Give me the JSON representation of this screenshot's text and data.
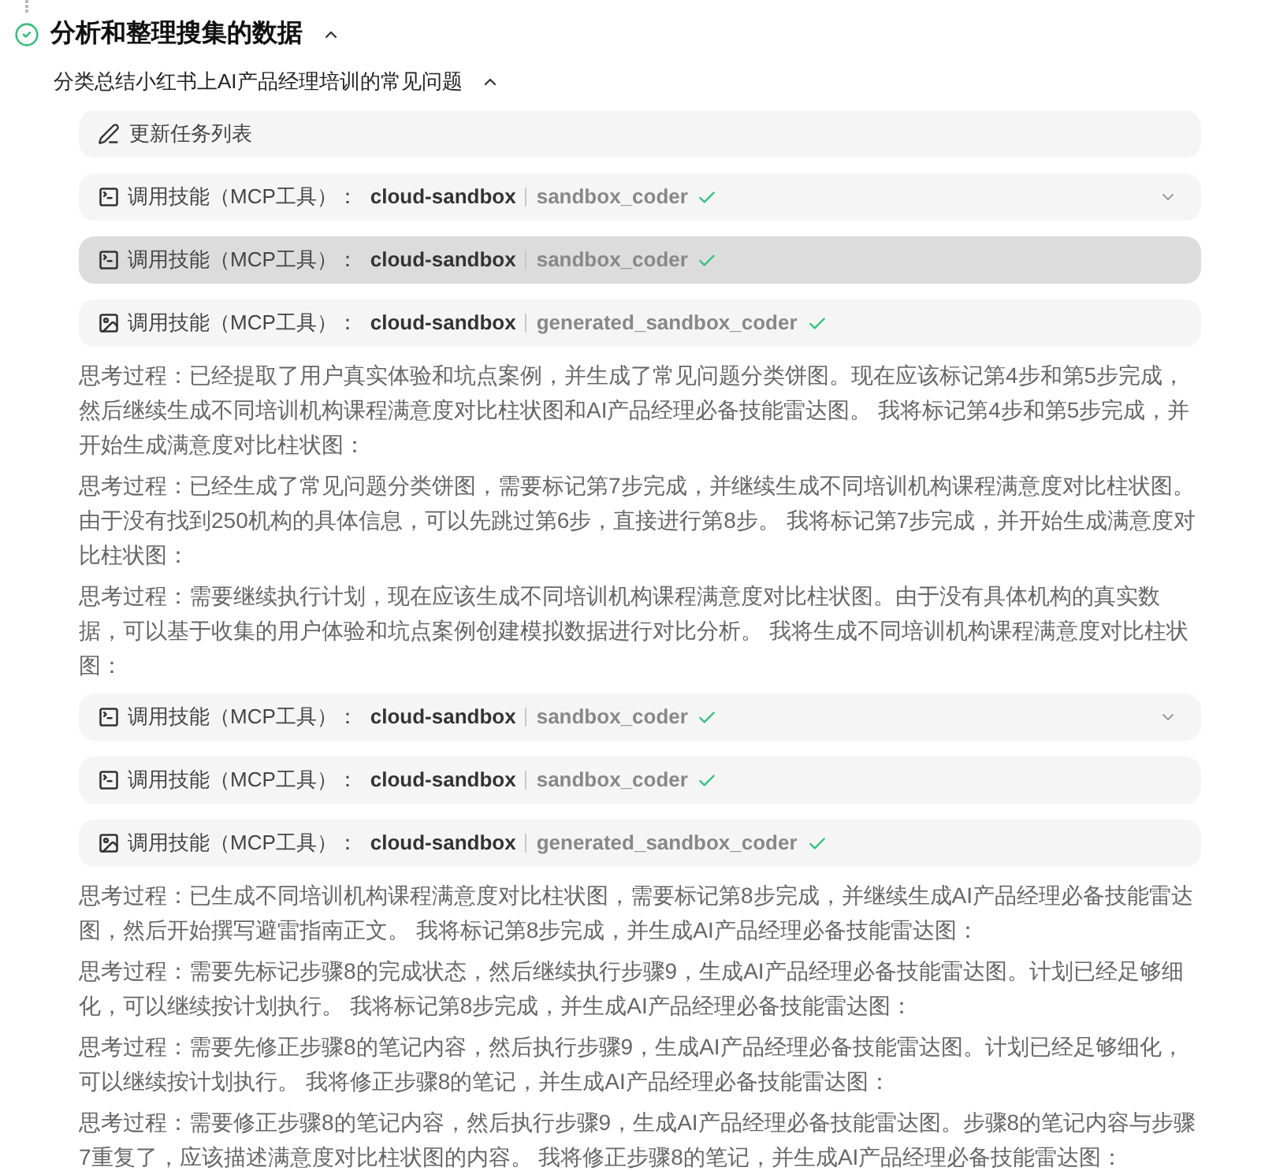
{
  "step": {
    "title": "分析和整理搜集的数据",
    "completed": true,
    "expanded": true
  },
  "subtask": {
    "title": "分类总结小红书上AI产品经理培训的常见问题",
    "expanded": true
  },
  "items": [
    {
      "kind": "task_update",
      "label": "更新任务列表"
    },
    {
      "kind": "terminal_tool",
      "label": "调用技能（MCP工具）：",
      "server": "cloud-sandbox",
      "tool": "sandbox_coder",
      "success": true,
      "chevron": true,
      "highlighted": false
    },
    {
      "kind": "terminal_tool",
      "label": "调用技能（MCP工具）：",
      "server": "cloud-sandbox",
      "tool": "sandbox_coder",
      "success": true,
      "chevron": false,
      "highlighted": true
    },
    {
      "kind": "image_tool",
      "label": "调用技能（MCP工具）：",
      "server": "cloud-sandbox",
      "tool": "generated_sandbox_coder",
      "success": true,
      "chevron": false,
      "highlighted": false
    },
    {
      "kind": "thought",
      "text": "思考过程：已经提取了用户真实体验和坑点案例，并生成了常见问题分类饼图。现在应该标记第4步和第5步完成，然后继续生成不同培训机构课程满意度对比柱状图和AI产品经理必备技能雷达图。 我将标记第4步和第5步完成，并开始生成满意度对比柱状图："
    },
    {
      "kind": "thought",
      "text": "思考过程：已经生成了常见问题分类饼图，需要标记第7步完成，并继续生成不同培训机构课程满意度对比柱状图。由于没有找到250机构的具体信息，可以先跳过第6步，直接进行第8步。 我将标记第7步完成，并开始生成满意度对比柱状图："
    },
    {
      "kind": "thought",
      "text": "思考过程：需要继续执行计划，现在应该生成不同培训机构课程满意度对比柱状图。由于没有具体机构的真实数据，可以基于收集的用户体验和坑点案例创建模拟数据进行对比分析。 我将生成不同培训机构课程满意度对比柱状图："
    },
    {
      "kind": "terminal_tool",
      "label": "调用技能（MCP工具）：",
      "server": "cloud-sandbox",
      "tool": "sandbox_coder",
      "success": true,
      "chevron": true,
      "highlighted": false
    },
    {
      "kind": "terminal_tool",
      "label": "调用技能（MCP工具）：",
      "server": "cloud-sandbox",
      "tool": "sandbox_coder",
      "success": true,
      "chevron": false,
      "highlighted": false
    },
    {
      "kind": "image_tool",
      "label": "调用技能（MCP工具）：",
      "server": "cloud-sandbox",
      "tool": "generated_sandbox_coder",
      "success": true,
      "chevron": false,
      "highlighted": false
    },
    {
      "kind": "thought",
      "text": "思考过程：已生成不同培训机构课程满意度对比柱状图，需要标记第8步完成，并继续生成AI产品经理必备技能雷达图，然后开始撰写避雷指南正文。 我将标记第8步完成，并生成AI产品经理必备技能雷达图："
    },
    {
      "kind": "thought",
      "text": "思考过程：需要先标记步骤8的完成状态，然后继续执行步骤9，生成AI产品经理必备技能雷达图。计划已经足够细化，可以继续按计划执行。 我将标记第8步完成，并生成AI产品经理必备技能雷达图："
    },
    {
      "kind": "thought",
      "text": "思考过程：需要先修正步骤8的笔记内容，然后执行步骤9，生成AI产品经理必备技能雷达图。计划已经足够细化，可以继续按计划执行。 我将修正步骤8的笔记，并生成AI产品经理必备技能雷达图："
    },
    {
      "kind": "thought",
      "text": "思考过程：需要修正步骤8的笔记内容，然后执行步骤9，生成AI产品经理必备技能雷达图。步骤8的笔记内容与步骤7重复了，应该描述满意度对比柱状图的内容。 我将修正步骤8的笔记，并生成AI产品经理必备技能雷达图："
    }
  ]
}
